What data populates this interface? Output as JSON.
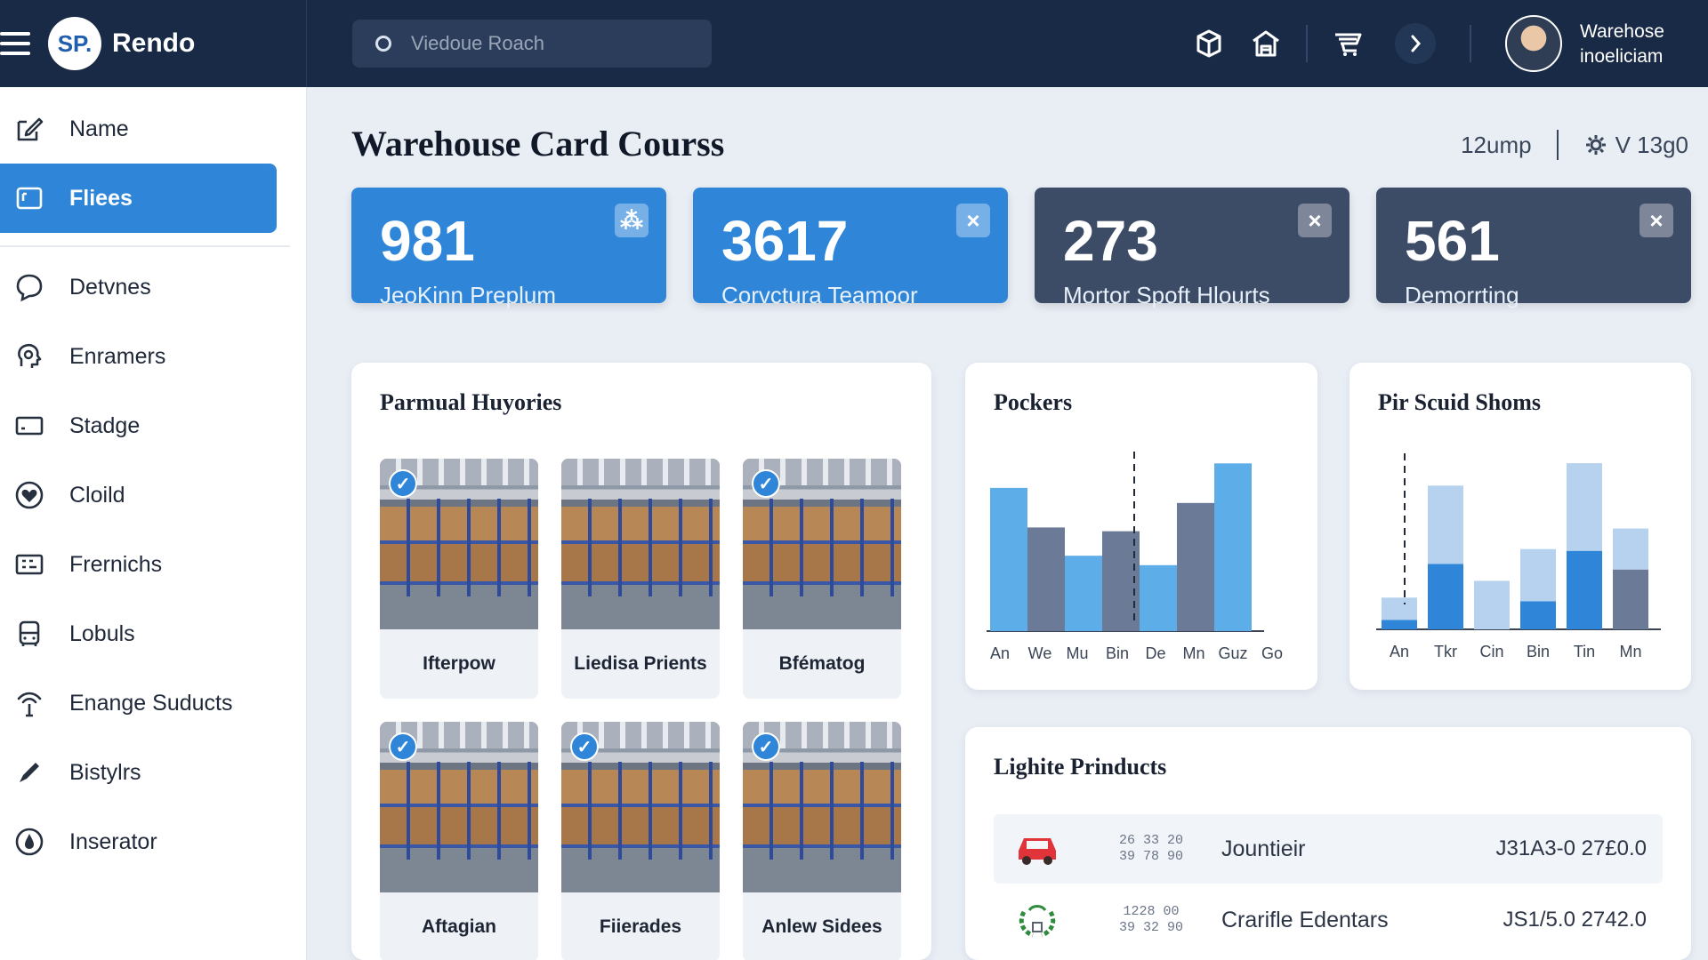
{
  "app": {
    "logo_mark": "SP.",
    "name": "Rendo"
  },
  "search": {
    "placeholder": "Viedoue Roach"
  },
  "toolbar_icons": [
    "box-icon",
    "warehouse-icon",
    "cart-icon",
    "collapse-icon"
  ],
  "user": {
    "line1": "Warehose",
    "line2": "inoeliciam"
  },
  "sidebar": {
    "items": [
      {
        "label": "Name",
        "icon": "edit-icon",
        "active": false
      },
      {
        "label": "Fliees",
        "icon": "folder-icon",
        "active": true
      },
      {
        "label": "Detvnes",
        "icon": "chat-icon",
        "active": false
      },
      {
        "label": "Enramers",
        "icon": "profile-icon",
        "active": false
      },
      {
        "label": "Stadge",
        "icon": "storage-icon",
        "active": false
      },
      {
        "label": "Cloild",
        "icon": "heart-icon",
        "active": false
      },
      {
        "label": "Frernichs",
        "icon": "grid-icon",
        "active": false
      },
      {
        "label": "Lobuls",
        "icon": "bus-icon",
        "active": false
      },
      {
        "label": "Enange Suducts",
        "icon": "signal-icon",
        "active": false
      },
      {
        "label": "Bistylrs",
        "icon": "pen-icon",
        "active": false
      },
      {
        "label": "Inserator",
        "icon": "drop-icon",
        "active": false
      }
    ]
  },
  "page": {
    "title": "Warehouse Card Courss",
    "meta_left": "12ump",
    "meta_right": "V 13g0"
  },
  "kpis": [
    {
      "value": "981",
      "label": "JeoKinn Preplum",
      "style": "blue"
    },
    {
      "value": "3617",
      "label": "Corvctura Teamoor",
      "style": "blue"
    },
    {
      "value": "273",
      "label": "Mortor Spoft Hlourts",
      "style": "dark"
    },
    {
      "value": "561",
      "label": "Demorrting",
      "style": "dark"
    }
  ],
  "photos": {
    "title": "Parmual Huyories",
    "items": [
      {
        "caption": "Ifterpow",
        "checked": true
      },
      {
        "caption": "Liedisa Prients",
        "checked": false
      },
      {
        "caption": "Bfématog",
        "checked": true
      },
      {
        "caption": "Aftagian",
        "checked": true
      },
      {
        "caption": "Fiierades",
        "checked": true
      },
      {
        "caption": "Anlew Sidees",
        "checked": true
      }
    ]
  },
  "chart_data": [
    {
      "type": "bar",
      "title": "Pockers",
      "categories": [
        "An",
        "We",
        "Mu",
        "Bin",
        "De",
        "Mn",
        "Guz",
        "Go"
      ],
      "values": [
        76,
        55,
        40,
        53,
        35,
        68,
        89,
        0
      ],
      "colors": [
        "#5dade8",
        "#6b7a96",
        "#5dade8",
        "#6b7a96",
        "#5dade8",
        "#6b7a96",
        "#5dade8"
      ],
      "ylim": [
        0,
        100
      ]
    },
    {
      "type": "bar",
      "title": "Pir Scuid Shoms",
      "categories": [
        "An",
        "Tkr",
        "Cin",
        "Bin",
        "Tin",
        "Mn"
      ],
      "series": [
        {
          "values": [
            5,
            35,
            0,
            15,
            42,
            32
          ]
        },
        {
          "values": [
            12,
            42,
            26,
            28,
            47,
            22
          ]
        }
      ],
      "colors": [
        "#2f86d9",
        "#b6d2ee"
      ],
      "ylim": [
        0,
        100
      ]
    }
  ],
  "products": {
    "title": "Lighite Prinducts",
    "rows": [
      {
        "icon": "car-icon",
        "code1": "26 33 20",
        "code2": "39 78 90",
        "name": "Jountieir",
        "value": "J31A3-0 27£0.0"
      },
      {
        "icon": "wreath-icon",
        "code1": "1228 00",
        "code2": "39 32 90",
        "name": "Crarifle Edentars",
        "value": "JS1/5.0 2742.0"
      }
    ]
  }
}
